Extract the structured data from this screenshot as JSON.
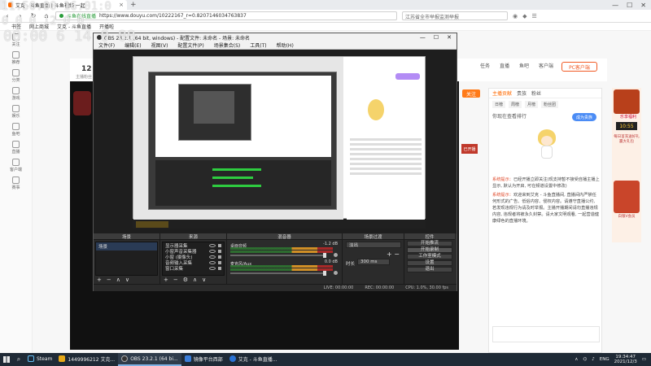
{
  "browser": {
    "tab_title": "艾克 - 斗鱼直播 | 斗鱼视频 一起",
    "url_site": "斗鱼在线直播",
    "url": "https://www.douyu.com/10222167_r=0.8207146034763837",
    "search_hint": "江苏省全市举报监测举报",
    "bookmarks": [
      "书签",
      "网上商城",
      "艾克 - 斗鱼直播",
      "开播啦"
    ]
  },
  "site": {
    "follow_label": "关注",
    "pc_button": "PC客户端",
    "stat_number": "12",
    "stat_sub": "主播粉丝",
    "left_nav": [
      "关注",
      "推荐",
      "分类",
      "游戏",
      "娱乐",
      "鱼吧",
      "直播",
      "客户端",
      "赛事"
    ],
    "top_icons": [
      "任务",
      "直播",
      "鱼吧",
      "客户端"
    ]
  },
  "chat": {
    "tabs": [
      "主播贡献",
      "贵族",
      "粉丝"
    ],
    "sub_tabs": [
      "日榜",
      "周榜",
      "月榜",
      "粉丝团"
    ],
    "banner": "你现在查看排行",
    "blue_button": "成为贵族",
    "messages": [
      {
        "tag": "系统提示：",
        "text": "已经开播立即关注(现支持暂不接受自播主播上显示, 默认为开启, 可在频道设置中修改)"
      },
      {
        "tag": "系统提示：",
        "text": "欢迎来到艾克 - 斗鱼直播间, 直播间内严禁任何形式的广告、低俗内容、侵权内容。请遵守直播公约, 若发现违规行为请及时举报。主播开播期间请勿直播违规内容, 违规者将被永久封禁。请大家文明观看, 一起营造健康绿色的直播环境。"
      }
    ]
  },
  "ads": {
    "title": "乐享福利",
    "countdown": "10:55",
    "small_text": "每日首充送好礼 赢大礼包",
    "badge": "白银V会员"
  },
  "obs": {
    "title": "OBS 23.2.1 (64 bit, windows) - 配置文件: 未命名 - 场景: 未命名",
    "menu": [
      "文件(F)",
      "编辑(E)",
      "视图(V)",
      "配置文件(P)",
      "场景集合(S)",
      "工具(T)",
      "帮助(H)"
    ],
    "dock_titles": {
      "scenes": "场景",
      "sources": "来源",
      "mixer": "混音器",
      "transitions": "场景过渡",
      "controls": "控件"
    },
    "scenes": [
      "场景"
    ],
    "sources": [
      "显示器采集",
      "小窗声音采集器",
      "小窗 (摄像头)",
      "音频输入采集",
      "窗口采集"
    ],
    "mixer": [
      {
        "name": "桌面音频",
        "db": "-1.2 dB"
      },
      {
        "name": "麦克风/Aux",
        "db": "0.0 dB"
      }
    ],
    "transition": {
      "type": "淡出",
      "duration_label": "时长",
      "duration": "300 ms"
    },
    "controls": [
      "开始推流",
      "开始录制",
      "工作室模式",
      "设置",
      "退出"
    ],
    "status": {
      "live": "LIVE: 00:00:00",
      "rec": "REC: 00:00:00",
      "cpu": "CPU: 1.0%, 30.00 fps"
    },
    "preview_badge": "已开播"
  },
  "taskbar": {
    "items": [
      {
        "label": "Steam",
        "color": "#1b2838"
      },
      {
        "label": "1449996212 艾克...",
        "color": "#e6a817"
      },
      {
        "label": "OBS 23.2.1 (64 bi...",
        "color": "#333333"
      },
      {
        "label": "镜像平台西部",
        "color": "#3b7dd8"
      },
      {
        "label": "艾克 - 斗鱼直播...",
        "color": "#2a72d4"
      }
    ],
    "lang": "ENG",
    "time": "19:34:47",
    "date": "2021/12/3"
  },
  "watermark": {
    "line1": "11:50:00 16:01:0",
    "line2": "0 0 0 12 0 0",
    "line3": "00:00 6  14 0 00"
  }
}
